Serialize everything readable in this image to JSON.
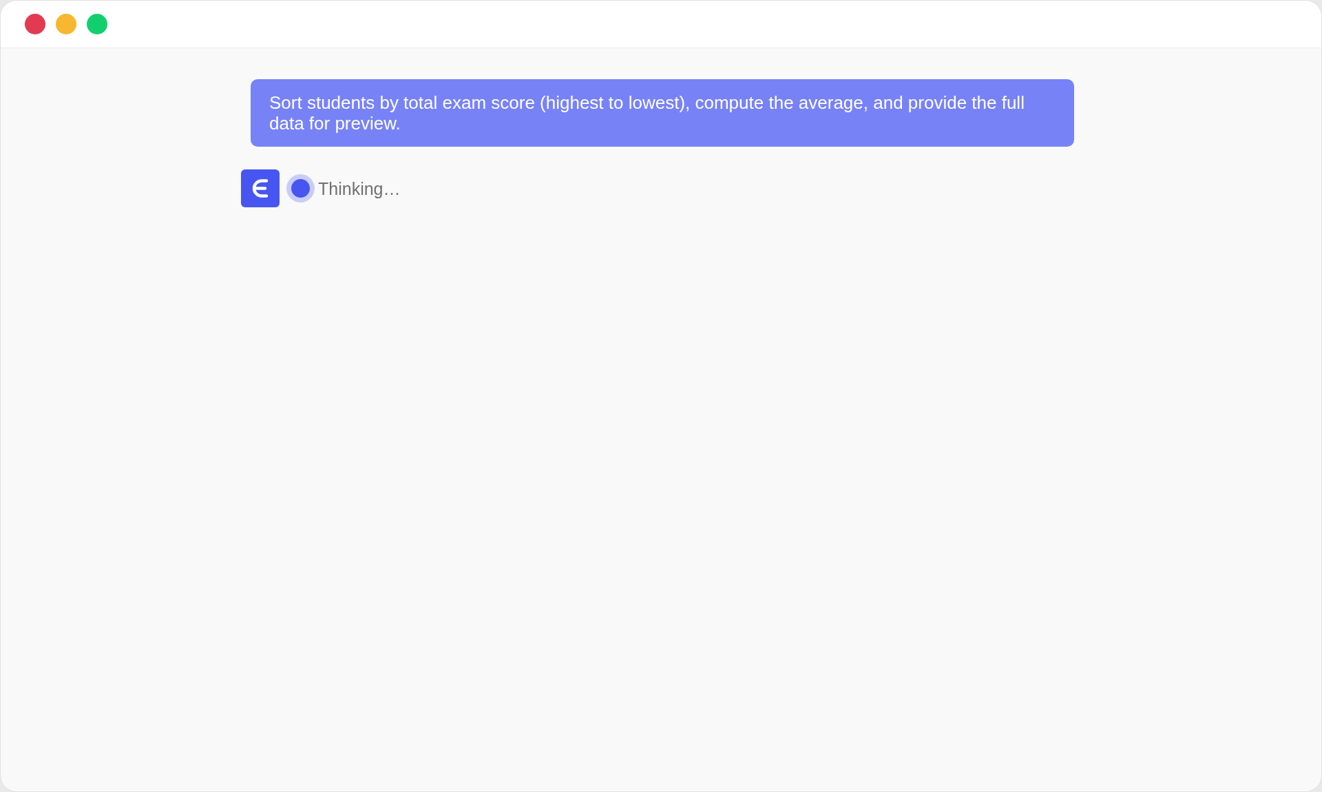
{
  "window": {
    "controls": [
      {
        "kind": "close"
      },
      {
        "kind": "minimize"
      },
      {
        "kind": "zoom"
      }
    ]
  },
  "conversation": [
    {
      "kind": "user_message",
      "text": "Sort students by total exam score (highest to lowest), compute the average, and provide the full data for preview."
    },
    {
      "kind": "assistant_status",
      "text": "Thinking…"
    }
  ]
}
